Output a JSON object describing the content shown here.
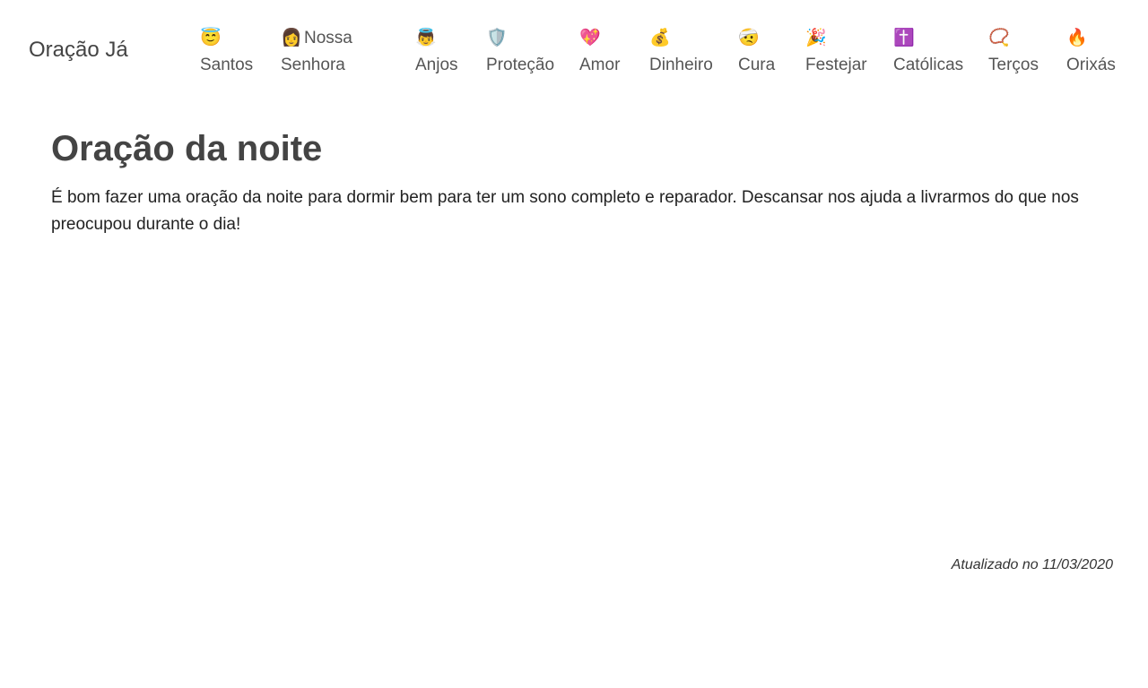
{
  "header": {
    "brand": "Oração Já",
    "nav": [
      {
        "icon": "😇",
        "icon_name": "halo-smile-icon",
        "line1": "",
        "line2": "Santos"
      },
      {
        "icon": "👩",
        "icon_name": "woman-icon",
        "line1": "Nossa",
        "line2": "Senhora"
      },
      {
        "icon": "👼",
        "icon_name": "baby-angel-icon",
        "line1": "",
        "line2": "Anjos"
      },
      {
        "icon": "🛡️",
        "icon_name": "shield-icon",
        "line1": "",
        "line2": "Proteção"
      },
      {
        "icon": "💖",
        "icon_name": "sparkling-heart-icon",
        "line1": "",
        "line2": "Amor"
      },
      {
        "icon": "💰",
        "icon_name": "money-bag-icon",
        "line1": "",
        "line2": "Dinheiro"
      },
      {
        "icon": "🤕",
        "icon_name": "bandaged-face-icon",
        "line1": "",
        "line2": "Cura"
      },
      {
        "icon": "🎉",
        "icon_name": "party-popper-icon",
        "line1": "",
        "line2": "Festejar"
      },
      {
        "icon": "✝️",
        "icon_name": "latin-cross-icon",
        "line1": "",
        "line2": "Católicas"
      },
      {
        "icon": "📿",
        "icon_name": "rosary-icon",
        "line1": "",
        "line2": "Terços"
      },
      {
        "icon": "🔥",
        "icon_name": "fire-icon",
        "line1": "",
        "line2": "Orixás"
      }
    ]
  },
  "main": {
    "title": "Oração da noite",
    "description": "É bom fazer uma oração da noite para dormir bem para ter um sono completo e reparador. Descansar nos ajuda a livrarmos do que nos preocupou durante o dia!",
    "updated": "Atualizado no 11/03/2020"
  }
}
